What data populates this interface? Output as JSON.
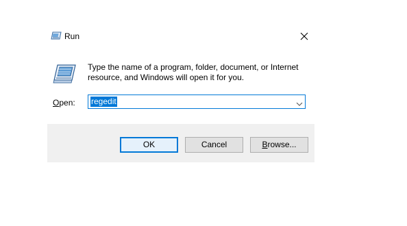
{
  "window": {
    "title": "Run",
    "title_icon": "run-icon",
    "close_icon": "close-icon"
  },
  "body": {
    "icon": "run-icon",
    "instructions": "Type the name of a program, folder, document, or Internet resource, and Windows will open it for you."
  },
  "open_field": {
    "label_mnemonic": "O",
    "label_rest": "pen:",
    "value": "regedit",
    "dropdown_icon": "chevron-down-icon"
  },
  "buttons": {
    "ok": "OK",
    "cancel": "Cancel",
    "browse_mnemonic": "B",
    "browse_rest": "rowse..."
  },
  "colors": {
    "accent": "#0078d7",
    "footer": "#f0f0f0"
  }
}
